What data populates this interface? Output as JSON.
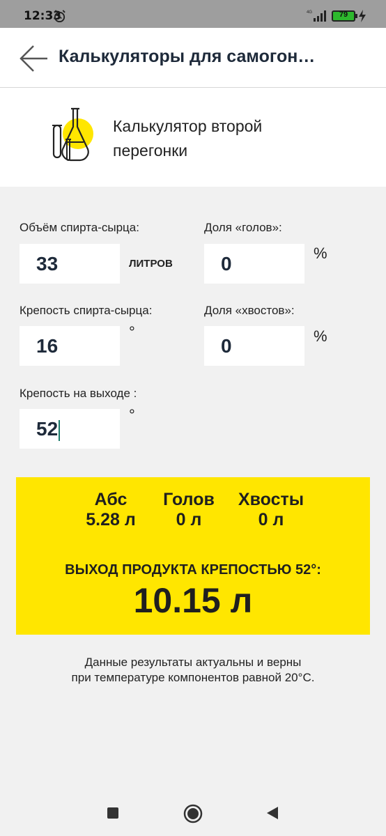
{
  "status_bar": {
    "time": "12:33",
    "battery": "79",
    "alarm_icon": "alarm-icon",
    "signal_icon": "signal-4g-icon",
    "charging_icon": "bolt-icon"
  },
  "app_bar": {
    "title": "Калькуляторы для самогон…",
    "back_icon": "arrow-left-icon"
  },
  "calculator": {
    "title": "Калькулятор второй перегонки",
    "icon": "flask-icon",
    "accent_color": "#ffe600"
  },
  "form": {
    "raw_volume": {
      "label": "Объём спирта-сырца:",
      "value": "33",
      "unit": "ЛИТРОВ"
    },
    "heads_share": {
      "label": "Доля «голов»:",
      "value": "0",
      "unit": "%"
    },
    "raw_strength": {
      "label": "Крепость спирта-сырца:",
      "value": "16",
      "unit": "°"
    },
    "tails_share": {
      "label": "Доля «хвостов»:",
      "value": "0",
      "unit": "%"
    },
    "output_strength": {
      "label": "Крепость на выходе :",
      "value": "52",
      "unit": "°"
    }
  },
  "result": {
    "columns": [
      {
        "header": "Абс",
        "value": "5.28 л"
      },
      {
        "header": "Голов",
        "value": "0 л"
      },
      {
        "header": "Хвосты",
        "value": "0 л"
      }
    ],
    "output_label": "ВЫХОД ПРОДУКТА КРЕПОСТЬЮ 52°:",
    "output_value": "10.15 л"
  },
  "note": {
    "line1": "Данные результаты актуальны и верны",
    "line2": "при температуре компонентов равной 20°С."
  },
  "nav": {
    "recents_icon": "square-icon",
    "home_icon": "circle-icon",
    "back_icon": "triangle-back-icon"
  }
}
